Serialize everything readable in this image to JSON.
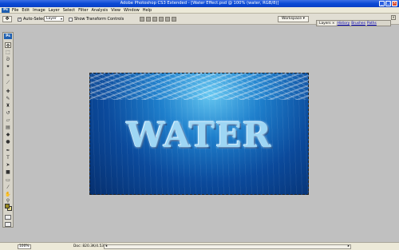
{
  "window": {
    "title": "Adobe Photoshop CS3 Extended - [Water Effect.psd @ 100% (water, RGB/8)]",
    "minimize": "_",
    "maximize": "□",
    "close": "×"
  },
  "menu": {
    "logo": "Ps",
    "items": [
      "File",
      "Edit",
      "Image",
      "Layer",
      "Select",
      "Filter",
      "Analysis",
      "View",
      "Window",
      "Help"
    ]
  },
  "options_bar": {
    "tool_icon": "move-tool-icon",
    "auto_select": {
      "label": "Auto-Select:",
      "checked": true,
      "value": "Layer"
    },
    "show_transform": {
      "label": "Show Transform Controls",
      "checked": false
    },
    "workspace_label": "Workspace ▾"
  },
  "panels": {
    "tabs": [
      "Layers ×",
      "History",
      "Brushes",
      "Paths"
    ],
    "active": "Layers ×",
    "close": "×"
  },
  "toolbox": {
    "badge": "Ps",
    "tools": [
      "move-tool",
      "marquee-tool",
      "lasso-tool",
      "magic-wand-tool",
      "crop-tool",
      "slice-tool",
      "healing-brush-tool",
      "brush-tool",
      "clone-stamp-tool",
      "history-brush-tool",
      "eraser-tool",
      "gradient-tool",
      "blur-tool",
      "dodge-tool",
      "pen-tool",
      "type-tool",
      "path-selection-tool",
      "shape-tool",
      "notes-tool",
      "eyedropper-tool",
      "hand-tool",
      "zoom-tool"
    ],
    "foreground_color": "#9a8a1e",
    "background_color": "#e8dd8a"
  },
  "document": {
    "text": "WATER"
  },
  "status_bar": {
    "zoom": "100%",
    "doc_info": "Doc: 820.3K/4.53M"
  }
}
